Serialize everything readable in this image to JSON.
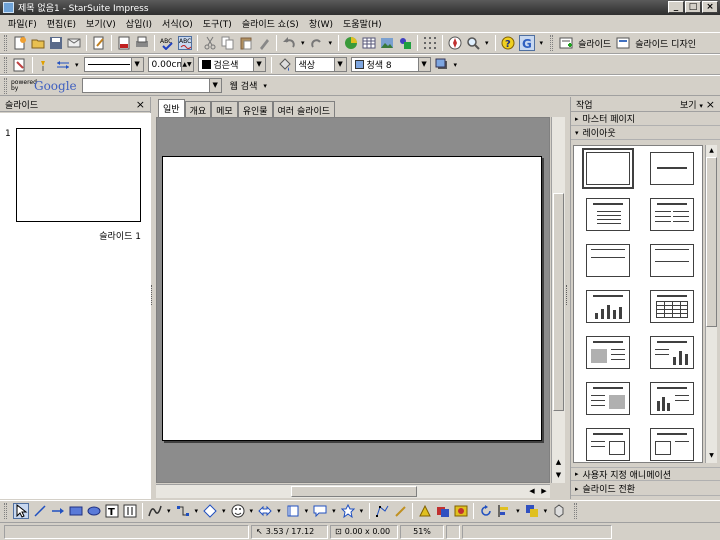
{
  "window": {
    "title": "제목 없음1 - StarSuite Impress"
  },
  "menu": [
    "파일(F)",
    "편집(E)",
    "보기(V)",
    "삽입(I)",
    "서식(O)",
    "도구(T)",
    "슬라이드 쇼(S)",
    "창(W)",
    "도움말(H)"
  ],
  "toolbar": {
    "slide_label": "슬라이드",
    "slide_design_label": "슬라이드 디자인"
  },
  "line_toolbar": {
    "line_width": "0.00cm",
    "line_color": "검은색",
    "area_style": "색상",
    "area_color": "청색 8"
  },
  "google": {
    "powered": "powered by",
    "brand": "Google",
    "search_label": "웹 검색",
    "query": ""
  },
  "slides_panel": {
    "title": "슬라이드",
    "close": "×",
    "slide_number": "1",
    "slide_name": "슬라이드 1"
  },
  "tabs": [
    "일반",
    "개요",
    "메모",
    "유인물",
    "여러 슬라이드"
  ],
  "task_panel": {
    "title": "작업",
    "view_label": "보기",
    "close": "×",
    "sections": {
      "master": "마스터 페이지",
      "layout": "레이아웃",
      "custom_animation": "사용자 지정 애니메이션",
      "transition": "슬라이드 전환"
    }
  },
  "status": {
    "position": "3.53 / 17.12",
    "size": "0.00 x 0.00",
    "zoom": "51%"
  },
  "colors": {
    "title_bar": "#3a3a3a",
    "ui_face": "#d4d0c8",
    "canvas_bg": "#8c8c8c"
  }
}
